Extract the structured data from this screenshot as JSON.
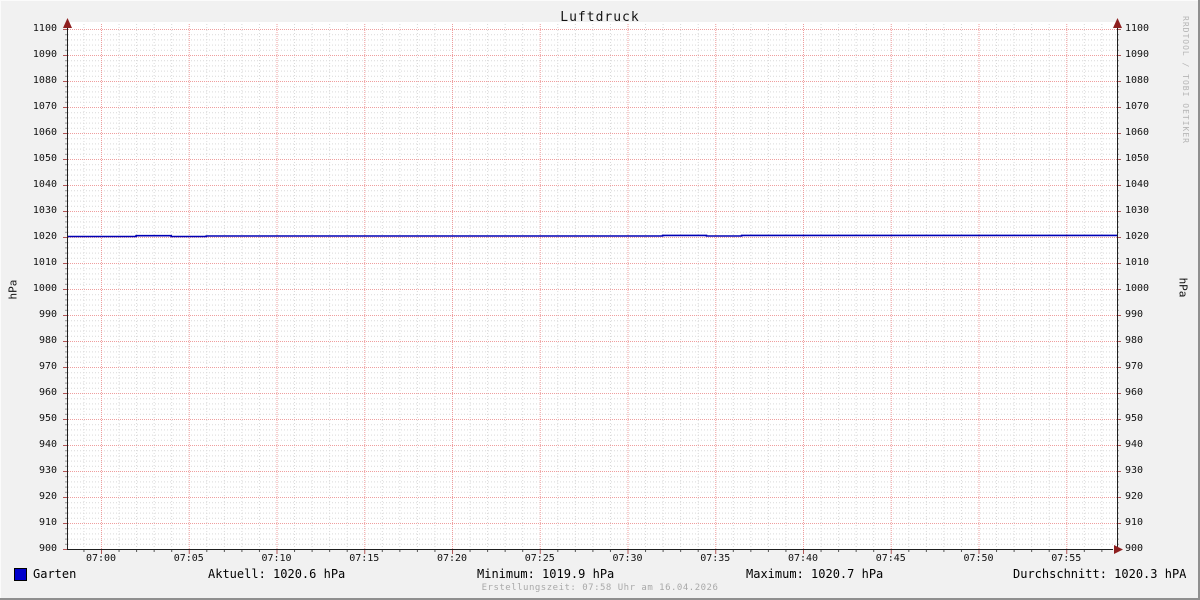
{
  "title": "Luftdruck",
  "watermark": "RRDTOOL / TOBI OETIKER",
  "axis": {
    "y_label_left": "hPa",
    "y_label_right": "hPa"
  },
  "legend": {
    "series_label": "Garten",
    "series_swatch_color": "#0000cc",
    "aktuell": "Aktuell: 1020.6 hPa",
    "minimum": "Minimum: 1019.9 hPa",
    "maximum": "Maximum: 1020.7 hPa",
    "durchschnitt": "Durchschnitt: 1020.3 hPA"
  },
  "footer": {
    "creation": "Erstellungszeit: 07:58 Uhr am 16.04.2026"
  },
  "chart_data": {
    "type": "line",
    "title": "Luftdruck",
    "ylabel": "hPa",
    "ylim": [
      900,
      1100
    ],
    "y_major_step": 10,
    "y_minor_step": 2,
    "y_tick_labels": [
      "900",
      "910",
      "920",
      "930",
      "940",
      "950",
      "960",
      "970",
      "980",
      "990",
      "1000",
      "1010",
      "1020",
      "1030",
      "1040",
      "1050",
      "1060",
      "1070",
      "1080",
      "1090",
      "1100"
    ],
    "x_tick_labels": [
      "07:00",
      "07:05",
      "07:10",
      "07:15",
      "07:20",
      "07:25",
      "07:30",
      "07:35",
      "07:40",
      "07:45",
      "07:50",
      "07:55"
    ],
    "x_tick_step_minutes": 5,
    "x_minor_step_minutes": 1,
    "x_range_minutes": [
      -1.9,
      57.8
    ],
    "grid": true,
    "legend_position": "bottom",
    "colors": {
      "plot_background": "#ffffff",
      "major_grid": "#ef9e9e",
      "minor_grid": "#d9d9d9",
      "axis": "#1f1f1f",
      "arrow": "#8e1f1f",
      "line": "#0000b4"
    },
    "series": [
      {
        "name": "Garten",
        "color": "#0000b4",
        "points_minutes_hpa": [
          [
            -1.9,
            1020.2
          ],
          [
            2.0,
            1020.5
          ],
          [
            4.0,
            1020.2
          ],
          [
            6.0,
            1020.4
          ],
          [
            32.0,
            1020.6
          ],
          [
            34.5,
            1020.4
          ],
          [
            36.5,
            1020.6
          ],
          [
            57.8,
            1020.6
          ]
        ]
      }
    ],
    "stats": {
      "aktuell_hpa": 1020.6,
      "minimum_hpa": 1019.9,
      "maximum_hpa": 1020.7,
      "durchschnitt_hpa": 1020.3
    }
  }
}
